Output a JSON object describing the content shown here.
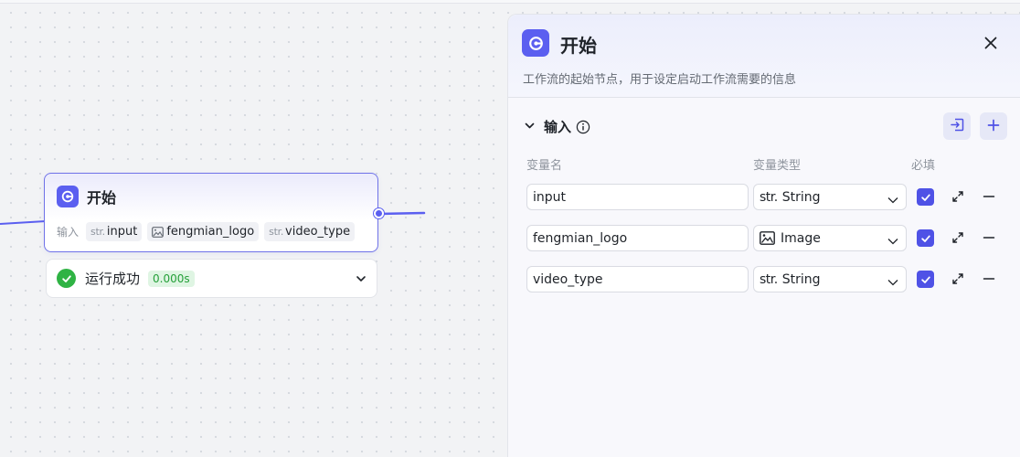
{
  "node": {
    "title": "开始",
    "params_label": "输入",
    "params": [
      {
        "type_label": "str.",
        "type_icon": "",
        "name": "input"
      },
      {
        "type_label": "",
        "type_icon": "image-icon",
        "name": "fengmian_logo"
      },
      {
        "type_label": "str.",
        "type_icon": "",
        "name": "video_type"
      }
    ]
  },
  "run_status": {
    "text": "运行成功",
    "duration": "0.000s",
    "status_color": "#2fb344"
  },
  "panel": {
    "title": "开始",
    "description": "工作流的起始节点，用于设定启动工作流需要的信息",
    "section_title": "输入",
    "columns": {
      "name": "变量名",
      "type": "变量类型",
      "required": "必填"
    },
    "rows": [
      {
        "name": "input",
        "type_prefix": "str.",
        "type_icon": "",
        "type": "String",
        "required": true
      },
      {
        "name": "fengmian_logo",
        "type_prefix": "",
        "type_icon": "image-icon",
        "type": "Image",
        "required": true
      },
      {
        "name": "video_type",
        "type_prefix": "str.",
        "type_icon": "",
        "type": "String",
        "required": true
      }
    ]
  },
  "colors": {
    "accent": "#5b5ff0",
    "checkbox": "#4f52e6",
    "success": "#2fb344"
  }
}
